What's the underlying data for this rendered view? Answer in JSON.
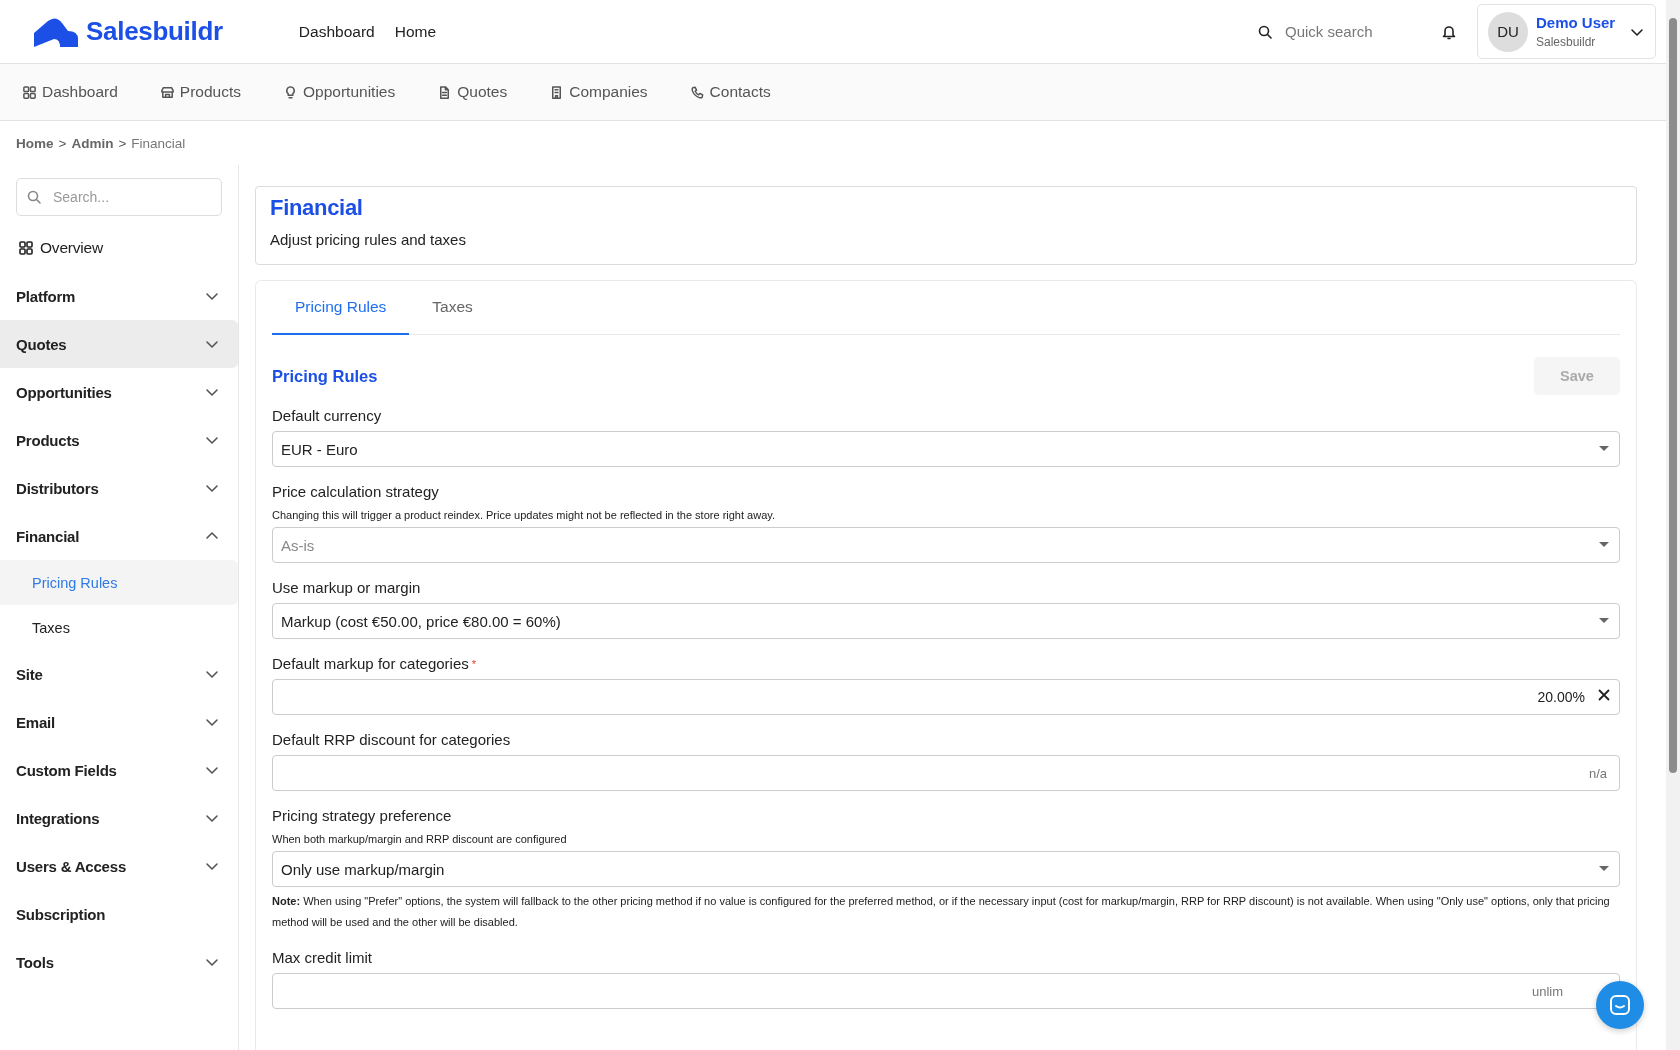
{
  "brand": {
    "name": "Salesbuildr"
  },
  "top_nav": [
    {
      "label": "Dashboard"
    },
    {
      "label": "Home"
    }
  ],
  "quick_search": {
    "placeholder": "Quick search"
  },
  "user": {
    "initials": "DU",
    "name": "Demo User",
    "company": "Salesbuildr"
  },
  "main_nav": [
    {
      "label": "Dashboard"
    },
    {
      "label": "Products"
    },
    {
      "label": "Opportunities"
    },
    {
      "label": "Quotes"
    },
    {
      "label": "Companies"
    },
    {
      "label": "Contacts"
    }
  ],
  "breadcrumb": [
    {
      "label": "Home",
      "current": false
    },
    {
      "label": "Admin",
      "current": false
    },
    {
      "label": "Financial",
      "current": true
    }
  ],
  "breadcrumb_separator": ">",
  "sidebar": {
    "search": {
      "placeholder": "Search..."
    },
    "items": [
      {
        "kind": "overview",
        "label": "Overview",
        "highlighted": false
      },
      {
        "kind": "group",
        "label": "Platform",
        "highlighted": false,
        "expanded": false
      },
      {
        "kind": "group",
        "label": "Quotes",
        "highlighted": true,
        "expanded": false
      },
      {
        "kind": "group",
        "label": "Opportunities",
        "highlighted": false,
        "expanded": false
      },
      {
        "kind": "group",
        "label": "Products",
        "highlighted": false,
        "expanded": false
      },
      {
        "kind": "group",
        "label": "Distributors",
        "highlighted": false,
        "expanded": false
      },
      {
        "kind": "group",
        "label": "Financial",
        "highlighted": false,
        "expanded": true,
        "children": [
          {
            "label": "Pricing Rules",
            "selected": true
          },
          {
            "label": "Taxes",
            "selected": false
          }
        ]
      },
      {
        "kind": "group",
        "label": "Site",
        "highlighted": false,
        "expanded": false
      },
      {
        "kind": "group",
        "label": "Email",
        "highlighted": false,
        "expanded": false
      },
      {
        "kind": "group",
        "label": "Custom Fields",
        "highlighted": false,
        "expanded": false
      },
      {
        "kind": "group",
        "label": "Integrations",
        "highlighted": false,
        "expanded": false
      },
      {
        "kind": "group",
        "label": "Users & Access",
        "highlighted": false,
        "expanded": false
      },
      {
        "kind": "link",
        "label": "Subscription",
        "highlighted": false
      },
      {
        "kind": "group",
        "label": "Tools",
        "highlighted": false,
        "expanded": false
      }
    ]
  },
  "page": {
    "title": "Financial",
    "subtitle": "Adjust pricing rules and taxes"
  },
  "tabs": [
    {
      "label": "Pricing Rules",
      "selected": true
    },
    {
      "label": "Taxes",
      "selected": false
    }
  ],
  "section": {
    "title": "Pricing Rules",
    "save_button": {
      "label": "Save",
      "disabled": true
    }
  },
  "required_marker": "*",
  "fields": [
    {
      "kind": "select",
      "label": "Default currency",
      "required": false,
      "clearable": false,
      "value": "EUR - Euro"
    },
    {
      "kind": "select",
      "label": "Price calculation strategy",
      "required": false,
      "clearable": false,
      "hint": "Changing this will trigger a product reindex. Price updates might not be reflected in the store right away.",
      "placeholder": "As-is"
    },
    {
      "kind": "select",
      "label": "Use markup or margin",
      "required": false,
      "clearable": false,
      "value": "Markup (cost €50.00, price €80.00 = 60%)"
    },
    {
      "kind": "input",
      "label": "Default markup for categories",
      "required": true,
      "clearable": true,
      "value": "20.00%"
    },
    {
      "kind": "input",
      "label": "Default RRP discount for categories",
      "required": false,
      "clearable": false,
      "placeholder": "n/a"
    },
    {
      "kind": "select",
      "label": "Pricing strategy preference",
      "required": false,
      "clearable": false,
      "hint": "When both markup/margin and RRP discount are configured",
      "value": "Only use markup/margin",
      "note": "**Note:** When using \"Prefer\" options, the system will fallback to the other pricing method if no value is configured for the preferred method, or if the necessary input (cost for markup/margin, RRP for RRP discount) is not available. When using \"Only use\" options, only that pricing method will be used and the other will be disabled."
    },
    {
      "kind": "input",
      "label": "Max credit limit",
      "required": false,
      "clearable": false,
      "placeholder": "unlim"
    }
  ]
}
